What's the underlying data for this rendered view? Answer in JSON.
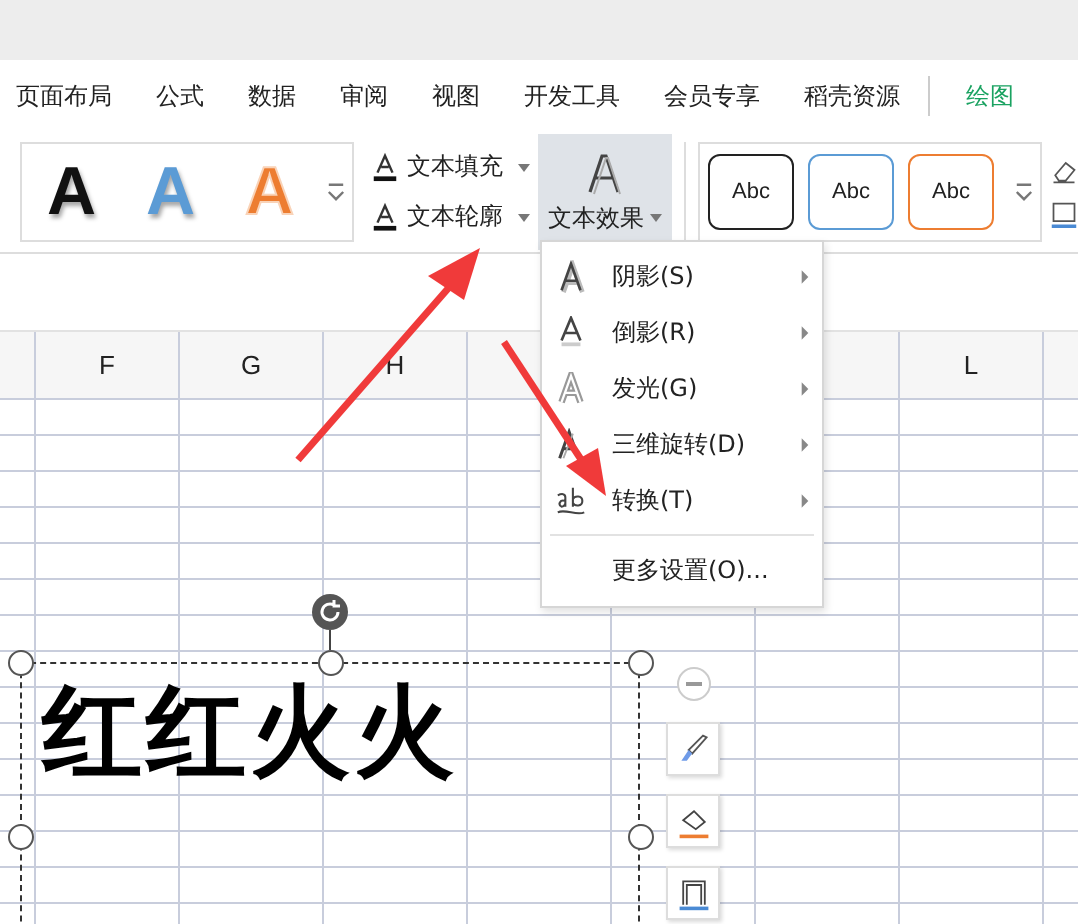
{
  "menu_tabs": [
    {
      "label": "页面布局",
      "kind": "normal"
    },
    {
      "label": "公式",
      "kind": "normal"
    },
    {
      "label": "数据",
      "kind": "normal"
    },
    {
      "label": "审阅",
      "kind": "normal"
    },
    {
      "label": "视图",
      "kind": "normal"
    },
    {
      "label": "开发工具",
      "kind": "normal"
    },
    {
      "label": "会员专享",
      "kind": "normal"
    },
    {
      "label": "稻壳资源",
      "kind": "normal"
    },
    {
      "label": "绘图",
      "kind": "contextual"
    }
  ],
  "ribbon": {
    "wordart_styles": [
      {
        "text": "A",
        "color": "#111111",
        "kind": "solid"
      },
      {
        "text": "A",
        "color": "#5b9bd5",
        "kind": "solid"
      },
      {
        "text": "A",
        "color": "#ed7d31",
        "kind": "outline"
      }
    ],
    "text_fill": "文本填充",
    "text_outline": "文本轮廓",
    "text_effects": {
      "label": "文本效果",
      "selected": true
    },
    "shape_styles": [
      {
        "text": "Abc",
        "color": "#222222"
      },
      {
        "text": "Abc",
        "color": "#5b9bd5"
      },
      {
        "text": "Abc",
        "color": "#ed7d31"
      }
    ]
  },
  "columns": [
    {
      "label": "F"
    },
    {
      "label": "G"
    },
    {
      "label": "H"
    },
    {},
    {},
    {},
    {
      "label": "L"
    }
  ],
  "effects_menu": [
    {
      "label": "阴影(S)",
      "kind": "shadow",
      "submenu": true
    },
    {
      "label": "倒影(R)",
      "kind": "reflection",
      "submenu": true
    },
    {
      "label": "发光(G)",
      "kind": "glow",
      "submenu": true
    },
    {
      "label": "三维旋转(D)",
      "kind": "rotate3d",
      "submenu": true
    },
    {
      "label": "转换(T)",
      "kind": "transform",
      "submenu": true
    },
    {
      "kind": "separator"
    },
    {
      "label": "更多设置(O)...",
      "kind": "plain",
      "submenu": false
    }
  ],
  "textbox": {
    "text": "红红火火"
  }
}
